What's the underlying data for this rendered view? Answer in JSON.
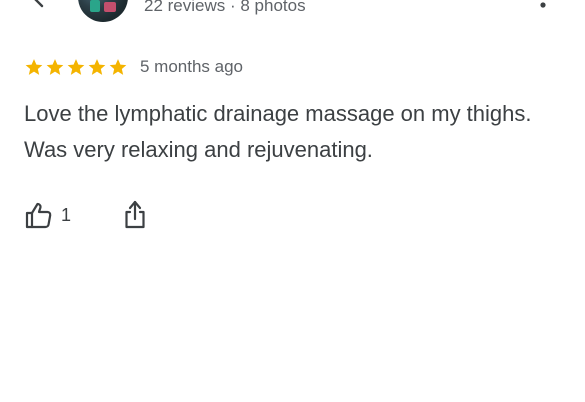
{
  "header": {
    "back_icon": "back-arrow-icon",
    "reviewer_stats": "22 reviews · 8 photos",
    "more_icon": "more-vert-icon"
  },
  "review": {
    "rating": 5,
    "rating_max": 5,
    "star_color": "#f4b400",
    "time_ago": "5 months ago",
    "text": "Love the lymphatic drainage massage on my thighs. Was very relaxing and rejuvenating."
  },
  "actions": {
    "like_icon": "thumb-up-icon",
    "like_count": "1",
    "share_icon": "share-icon"
  }
}
